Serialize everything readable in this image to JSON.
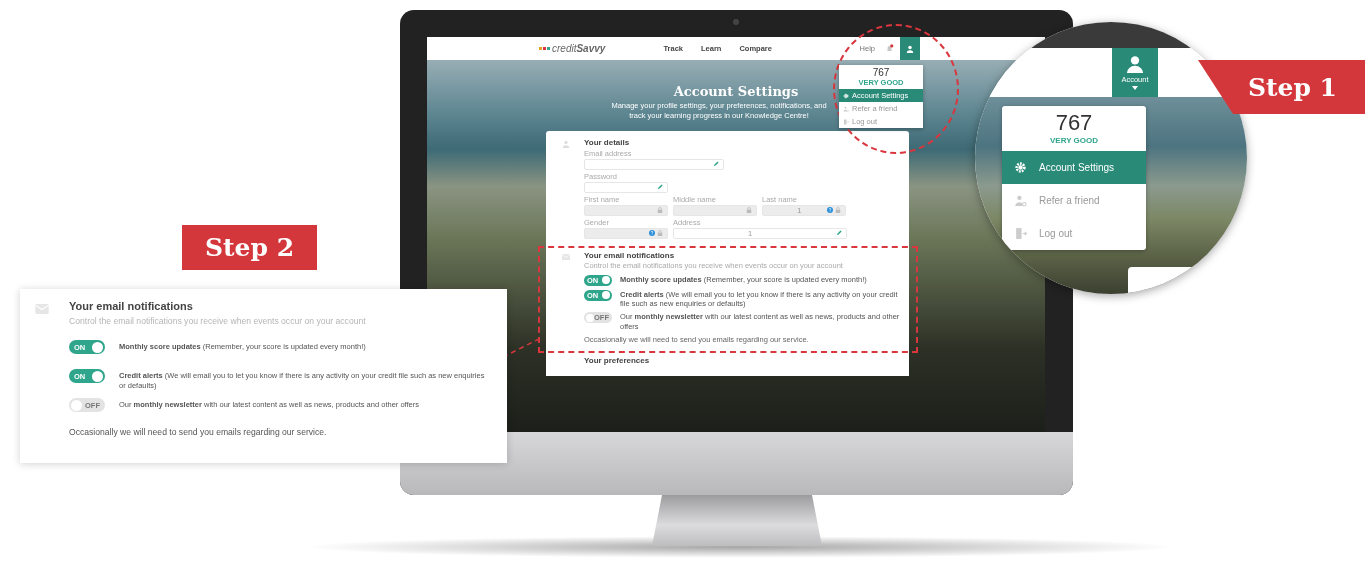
{
  "monitor": {
    "nav": {
      "logo": "credit**Savvy**",
      "links": [
        {
          "label": "Track"
        },
        {
          "label": "Learn"
        },
        {
          "label": "Compare"
        }
      ],
      "help": "Help"
    },
    "hero": {
      "title": "Account Settings",
      "subtitle": "Manage your profile settings, your preferences, notifications, and track your learning progress in our Knowledge Centre!"
    },
    "menu": {
      "score": "767",
      "rating": "VERY GOOD",
      "items": [
        {
          "label": "Account Settings",
          "kind": "gear",
          "selected": true
        },
        {
          "label": "Refer a friend",
          "kind": "refer",
          "selected": false
        },
        {
          "label": "Log out",
          "kind": "logout",
          "selected": false
        }
      ]
    },
    "details": {
      "title": "Your details",
      "rows": [
        [
          {
            "label": "Email address",
            "kind": "edit",
            "help": false
          }
        ],
        [
          {
            "label": "Password",
            "kind": "edit",
            "help": false
          }
        ],
        [
          {
            "label": "First name",
            "kind": "locked",
            "help": false
          },
          {
            "label": "Middle name",
            "kind": "locked",
            "help": false
          },
          {
            "label": "Last name",
            "value": "1",
            "kind": "locked",
            "help": true
          }
        ],
        [
          {
            "label": "Gender",
            "kind": "locked",
            "help": true
          },
          {
            "label": "Address",
            "value": "1",
            "kind": "edit",
            "help": false
          }
        ]
      ]
    },
    "notifications": {
      "title": "Your email notifications",
      "subtitle": "Control the email notifications you receive when events occur on your account",
      "items": [
        {
          "on": true,
          "state_label": "ON",
          "text": "**Monthly score updates** (Remember, your score is updated every month!)"
        },
        {
          "on": true,
          "state_label": "ON",
          "text": "**Credit alerts** (We will email you to let you know if there is any activity on your credit file such as new enquiries or defaults)"
        },
        {
          "on": false,
          "state_label": "OFF",
          "text": "Our **monthly newsletter** with our latest content as well as news, products and other offers"
        }
      ],
      "footer": "Occasionally we will need to send you emails regarding our service."
    },
    "next_section": "Your preferences"
  },
  "callout": {
    "step": "Step 2",
    "notifications": {
      "title": "Your email notifications",
      "subtitle": "Control the email notifications you receive when events occur on your account",
      "items": [
        {
          "on": true,
          "state_label": "ON",
          "text": "**Monthly score updates** (Remember, your score is updated every month!)"
        },
        {
          "on": true,
          "state_label": "ON",
          "text": "**Credit alerts** (We will email you to let you know if there is any activity on your credit file such as new enquiries or defaults)"
        },
        {
          "on": false,
          "state_label": "OFF",
          "text": "Our **monthly newsletter** with our latest content as well as news, products and other offers"
        }
      ],
      "footer": "Occasionally we will need to send you emails regarding our service."
    }
  },
  "zoom": {
    "step": "Step 1",
    "account_label": "Account",
    "menu": {
      "score": "767",
      "rating": "VERY GOOD",
      "items": [
        {
          "label": "Account Settings",
          "kind": "gear",
          "selected": true
        },
        {
          "label": "Refer a friend",
          "kind": "refer",
          "selected": false
        },
        {
          "label": "Log out",
          "kind": "logout",
          "selected": false
        }
      ]
    }
  }
}
